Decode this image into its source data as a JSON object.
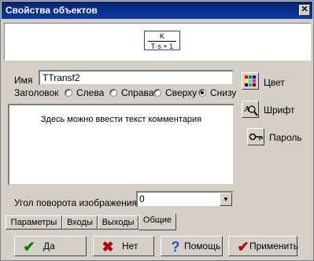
{
  "window": {
    "title": "Свойства объектов",
    "close_glyph": "✕"
  },
  "preview": {
    "numerator": "K",
    "denominator": "T·s + 1"
  },
  "name": {
    "label": "Имя",
    "value": "TTransf2"
  },
  "header": {
    "label": "Заголовок",
    "options": [
      {
        "label": "Слева",
        "checked": false
      },
      {
        "label": "Справа",
        "checked": false
      },
      {
        "label": "Сверху",
        "checked": true
      },
      {
        "label": "Снизу",
        "checked": false
      }
    ]
  },
  "comment": {
    "text": "Здесь можно ввести текст комментария"
  },
  "side_buttons": {
    "color": "Цвет",
    "font": "Шрифт",
    "password": "Пароль"
  },
  "rotation": {
    "label": "Угол поворота изображения",
    "value": "0"
  },
  "tabs": [
    "Параметры",
    "Входы",
    "Выходы",
    "Общие"
  ],
  "active_tab": "Общие",
  "buttons": {
    "yes": "Да",
    "no": "Нет",
    "help": "Помощь",
    "apply": "Применить"
  },
  "colors": {
    "title_bar": "#0a246a",
    "frame": "#d4d0c8",
    "ok_check": "#008000",
    "no_cross": "#c00000",
    "help_question": "#1060b0"
  }
}
